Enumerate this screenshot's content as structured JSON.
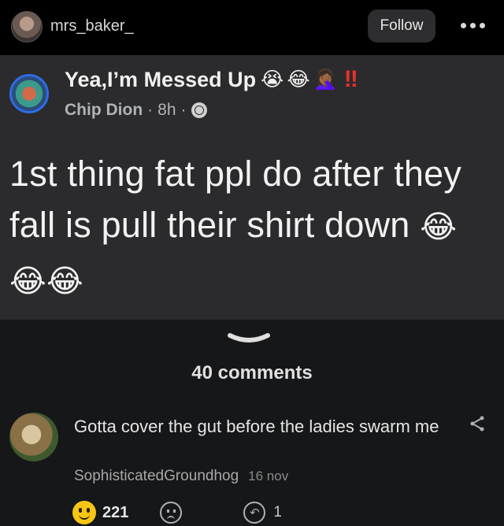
{
  "header": {
    "username": "mrs_baker_",
    "follow_label": "Follow"
  },
  "post": {
    "group_title": "Yea,I’m Messed Up",
    "title_emojis": [
      "😭",
      "😂",
      "🤦🏾‍♀️"
    ],
    "title_bang": "‼",
    "author": "Chip Dion",
    "separator": "·",
    "time": "8h",
    "text": "1st thing fat ppl do after they fall is pull their shirt down",
    "text_emojis": "😂😂😂"
  },
  "comments": {
    "count_label": "40 comments",
    "items": [
      {
        "text": "Gotta cover the gut before the ladies swarm me",
        "author": "SophisticatedGroundhog",
        "date": "16 nov",
        "likes": "221",
        "replies": "1"
      }
    ]
  },
  "colors": {
    "background": "#161719",
    "post_card": "#2b2b2d",
    "top_bar": "#000000",
    "avatar_ring": "#2e6be6"
  },
  "icons": [
    "more-icon",
    "globe-icon",
    "chevron-down-icon",
    "share-icon",
    "smile-icon",
    "sad-icon",
    "reply-icon"
  ]
}
